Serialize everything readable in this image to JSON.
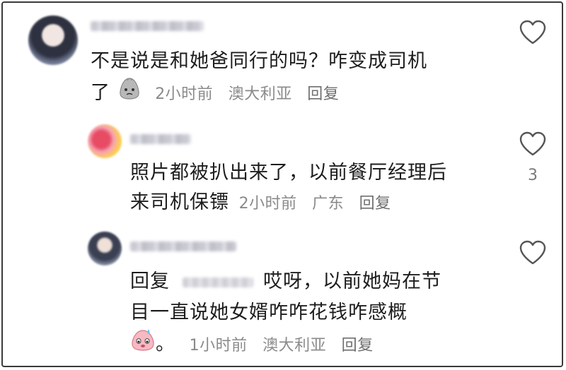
{
  "comments": [
    {
      "text_line1": "不是说是和她爸同行的吗？咋变成司机",
      "text_line2": "了",
      "time": "2小时前",
      "location": "澳大利亚",
      "reply_label": "回复",
      "like_count": ""
    },
    {
      "text_line1": "照片都被扒出来了，以前餐厅经理后",
      "text_line2": "来司机保镖",
      "time": "2小时前",
      "location": "广东",
      "reply_label": "回复",
      "like_count": "3"
    },
    {
      "reply_prefix": "回复",
      "text_line1_rest": "哎呀，以前她妈在节",
      "text_line2": "目一直说她女婿咋咋花钱咋感概",
      "text_line3_suffix": "。",
      "time": "1小时前",
      "location": "澳大利亚",
      "reply_label": "回复",
      "like_count": ""
    }
  ],
  "colors": {
    "text": "#1d1d1d",
    "meta": "#8a8a8a",
    "icon": "#555555"
  },
  "icons": {
    "like": "heart-outline-icon",
    "emoji1": "sad-face-emoji",
    "emoji2": "sweat-face-emoji"
  }
}
